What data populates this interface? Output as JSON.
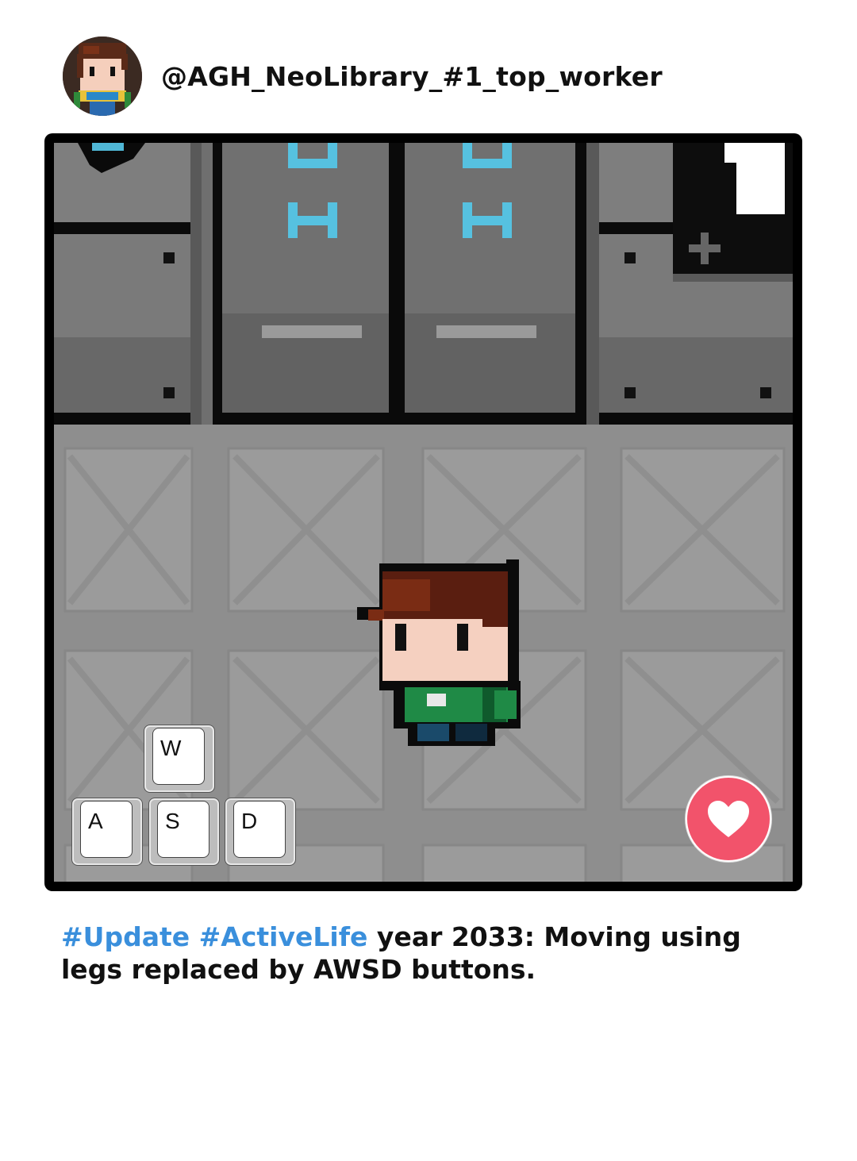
{
  "post": {
    "username": "@AGH_NeoLibrary_#1_top_worker",
    "avatar_icon": "pixel-character-avatar",
    "keys": {
      "w": "W",
      "a": "A",
      "s": "S",
      "d": "D"
    },
    "like_icon": "heart-icon",
    "caption": {
      "tag1": "#Update",
      "tag2": "#ActiveLife",
      "text": " year 2033: Moving using legs replaced by AWSD buttons."
    }
  },
  "colors": {
    "tag": "#3a8fdc",
    "like": "#f2536b"
  }
}
